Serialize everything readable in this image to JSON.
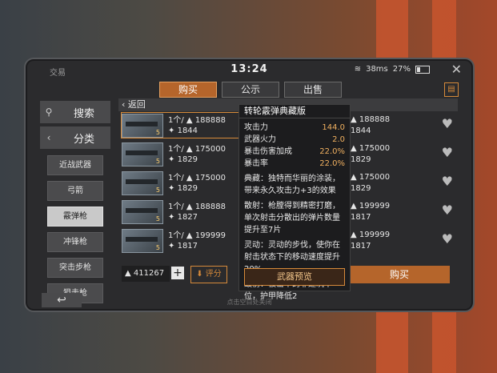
{
  "status": {
    "app_label": "交易",
    "time": "13:24",
    "ping": "38ms",
    "battery": "27%"
  },
  "tabs": [
    {
      "label": "购买"
    },
    {
      "label": "公示"
    },
    {
      "label": "出售"
    }
  ],
  "sidebar": {
    "search_label": "搜索",
    "category_label": "分类",
    "items": [
      {
        "label": "近战武器"
      },
      {
        "label": "弓箭"
      },
      {
        "label": "霰弹枪"
      },
      {
        "label": "冲锋枪"
      },
      {
        "label": "突击步枪"
      },
      {
        "label": "狙击枪"
      }
    ]
  },
  "back_label": "返回",
  "listings_left": [
    {
      "qty": "1个/",
      "price": "188888",
      "level": "5",
      "note": "1844"
    },
    {
      "qty": "1个/",
      "price": "175000",
      "level": "5",
      "note": "1829"
    },
    {
      "qty": "1个/",
      "price": "175000",
      "level": "5",
      "note": "1829"
    },
    {
      "qty": "1个/",
      "price": "188888",
      "level": "5",
      "note": "1827"
    },
    {
      "qty": "1个/",
      "price": "199999",
      "level": "5",
      "note": "1817"
    }
  ],
  "listings_right": [
    {
      "price": "188888",
      "note": "1844"
    },
    {
      "price": "175000",
      "note": "1829"
    },
    {
      "price": "175000",
      "note": "1829"
    },
    {
      "price": "199999",
      "note": "1817"
    },
    {
      "price": "199999",
      "note": "1817"
    }
  ],
  "wallet": {
    "amount": "411267",
    "plus": "+",
    "rate_label": "评分"
  },
  "buy_label": "购买",
  "footer_hint": "点击空白处关闭",
  "popup": {
    "title": "转轮霰弹典藏版",
    "stats": [
      {
        "label": "攻击力",
        "value": "144.0"
      },
      {
        "label": "武器火力",
        "value": "2.0"
      },
      {
        "label": "暴击伤害加成",
        "value": "22.0%"
      },
      {
        "label": "暴击率",
        "value": "22.0%"
      }
    ],
    "desc": [
      "典藏：独特而华丽的涂装，带来永久攻击力+3的效果",
      "散射：枪膛得到精密打磨，单次射击分散出的弹片数量提升至7片",
      "灵动：灵动的步伐，使你在射击状态下的移动速度提升20%",
      "毁伤：被击中的非建筑单位，护甲降低2"
    ],
    "preview_label": "武器预览"
  }
}
